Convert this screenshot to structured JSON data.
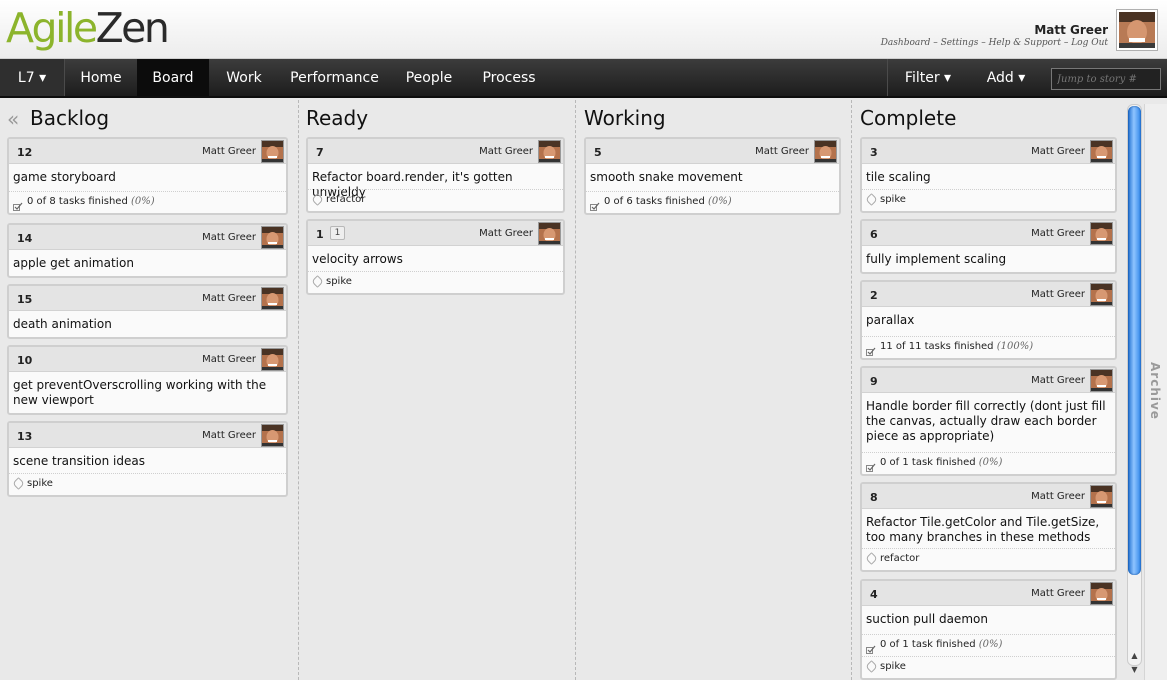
{
  "app": {
    "logo_agile": "Agile",
    "logo_zen": "Zen"
  },
  "user": {
    "name": "Matt Greer",
    "links": [
      "Dashboard",
      "Settings",
      "Help & Support",
      "Log Out"
    ],
    "link_sep": " – "
  },
  "nav": {
    "project": "L7 ▾",
    "items": [
      "Home",
      "Board",
      "Work",
      "Performance",
      "People",
      "Process"
    ],
    "active": "Board",
    "filter": "Filter ▾",
    "add": "Add ▾",
    "jump_placeholder": "Jump to story #"
  },
  "archive_label": "Archive",
  "columns": [
    {
      "title": "Backlog",
      "cards": [
        {
          "id": "12",
          "owner": "Matt Greer",
          "title": "game storyboard",
          "tasks": "0 of 8 tasks finished",
          "pct": "(0%)"
        },
        {
          "id": "14",
          "owner": "Matt Greer",
          "title": "apple get animation"
        },
        {
          "id": "15",
          "owner": "Matt Greer",
          "title": "death animation"
        },
        {
          "id": "10",
          "owner": "Matt Greer",
          "title": "get preventOverscrolling working with the new viewport"
        },
        {
          "id": "13",
          "owner": "Matt Greer",
          "title": "scene transition ideas",
          "tag": "spike"
        }
      ]
    },
    {
      "title": "Ready",
      "cards": [
        {
          "id": "7",
          "owner": "Matt Greer",
          "title": "Refactor board.render, it's gotten unwieldy",
          "tag": "refactor"
        },
        {
          "id": "1",
          "badge": "1",
          "owner": "Matt Greer",
          "title": "velocity arrows",
          "tag": "spike"
        }
      ]
    },
    {
      "title": "Working",
      "cards": [
        {
          "id": "5",
          "owner": "Matt Greer",
          "title": "smooth snake movement",
          "tasks": "0 of 6 tasks finished",
          "pct": "(0%)"
        }
      ]
    },
    {
      "title": "Complete",
      "cards": [
        {
          "id": "3",
          "owner": "Matt Greer",
          "title": "tile scaling",
          "tag": "spike"
        },
        {
          "id": "6",
          "owner": "Matt Greer",
          "title": "fully implement scaling"
        },
        {
          "id": "2",
          "owner": "Matt Greer",
          "title": "parallax",
          "tasks": "11 of 11 tasks finished",
          "pct": "(100%)"
        },
        {
          "id": "9",
          "owner": "Matt Greer",
          "title": "Handle border fill correctly (dont just fill the canvas, actually draw each border piece as appropriate)",
          "tasks": "0 of 1 task finished",
          "pct": "(0%)"
        },
        {
          "id": "8",
          "owner": "Matt Greer",
          "title": "Refactor Tile.getColor and Tile.getSize, too many branches in these methods",
          "tag": "refactor"
        },
        {
          "id": "4",
          "owner": "Matt Greer",
          "title": "suction pull daemon",
          "tasks": "0 of 1 task finished",
          "pct": "(0%)",
          "tag": "spike"
        }
      ]
    }
  ],
  "colors": {
    "logo_green": "#8cb42c",
    "nav_bg": "#2b2b2b",
    "active_tab": "#0c0c0c",
    "scroll_blue": "#2f86ea"
  }
}
